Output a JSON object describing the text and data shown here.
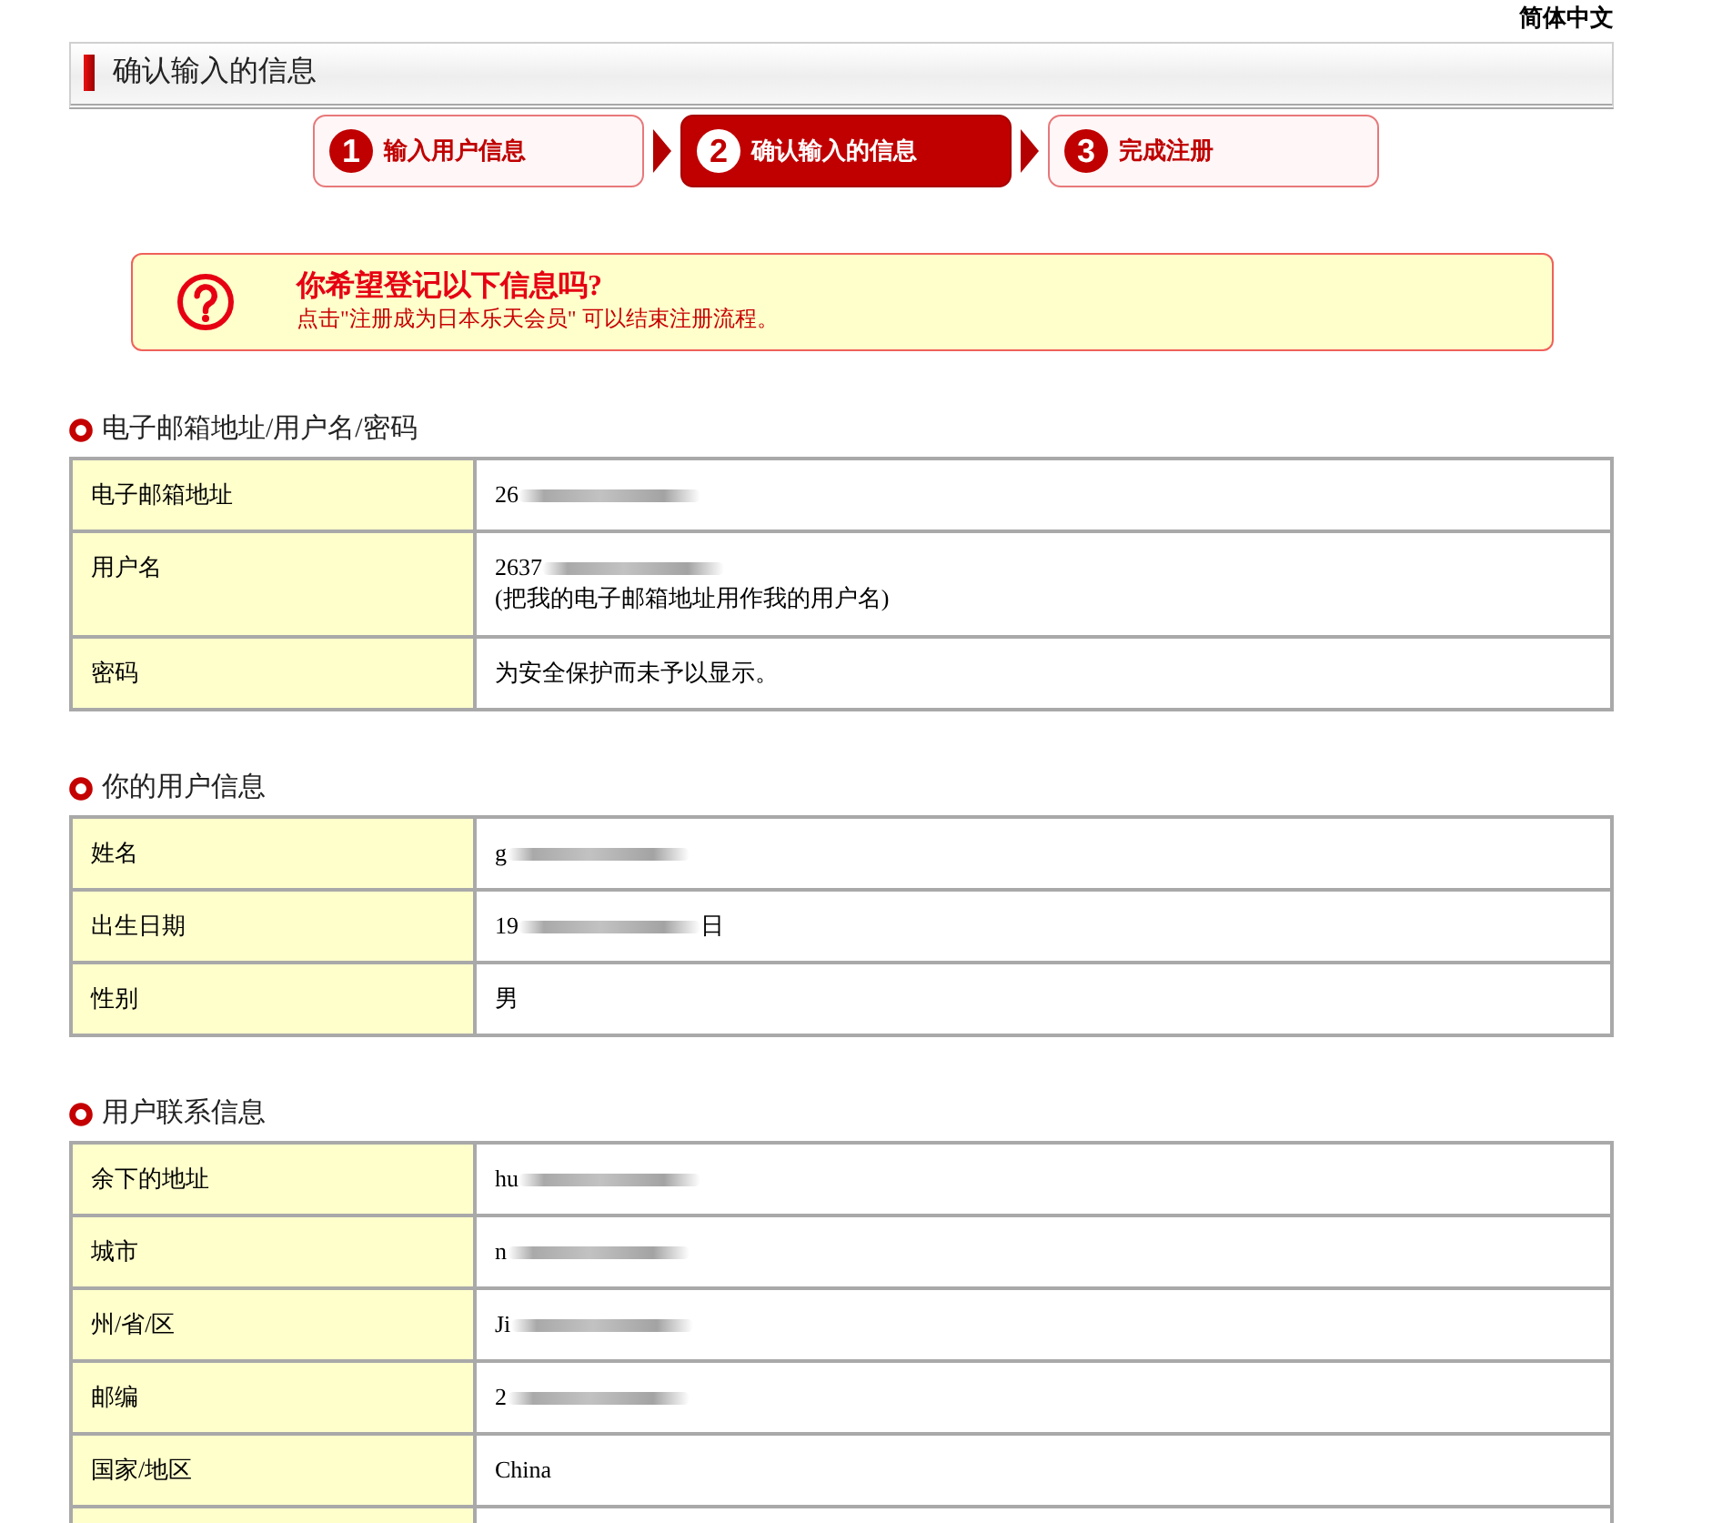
{
  "language_link": "简体中文",
  "page_title": "确认输入的信息",
  "steps": [
    {
      "number": "1",
      "label": "输入用户信息",
      "current": false
    },
    {
      "number": "2",
      "label": "确认输入的信息",
      "current": true
    },
    {
      "number": "3",
      "label": "完成注册",
      "current": false
    }
  ],
  "notice": {
    "title": "你希望登记以下信息吗?",
    "message": "点击\"注册成为日本乐天会员\" 可以结束注册流程。"
  },
  "sections": [
    {
      "heading": "电子邮箱地址/用户名/密码",
      "rows": [
        {
          "kind": "field",
          "label": "电子邮箱地址",
          "value": "26",
          "redacted": true
        },
        {
          "kind": "field",
          "label": "用户名",
          "value": "2637",
          "redacted": true,
          "note": "(把我的电子邮箱地址用作我的用户名)"
        },
        {
          "kind": "field",
          "label": "密码",
          "value": "为安全保护而未予以显示。",
          "redacted": false
        }
      ]
    },
    {
      "heading": "你的用户信息",
      "rows": [
        {
          "kind": "field",
          "label": "姓名",
          "value": "g",
          "redacted": true
        },
        {
          "kind": "field",
          "label": "出生日期",
          "value": "19",
          "redacted": true,
          "value_after": "日"
        },
        {
          "kind": "field",
          "label": "性别",
          "value": "男",
          "redacted": false
        }
      ]
    },
    {
      "heading": "用户联系信息",
      "rows": [
        {
          "kind": "field",
          "label": "余下的地址",
          "value": "hu",
          "redacted": true
        },
        {
          "kind": "field",
          "label": "城市",
          "value": "n",
          "redacted": true
        },
        {
          "kind": "field",
          "label": "州/省/区",
          "value": "Ji",
          "redacted": true
        },
        {
          "kind": "field",
          "label": "邮编",
          "value": "2",
          "redacted": true
        },
        {
          "kind": "field",
          "label": "国家/地区",
          "value": "China",
          "redacted": false
        },
        {
          "kind": "cut"
        }
      ]
    }
  ]
}
